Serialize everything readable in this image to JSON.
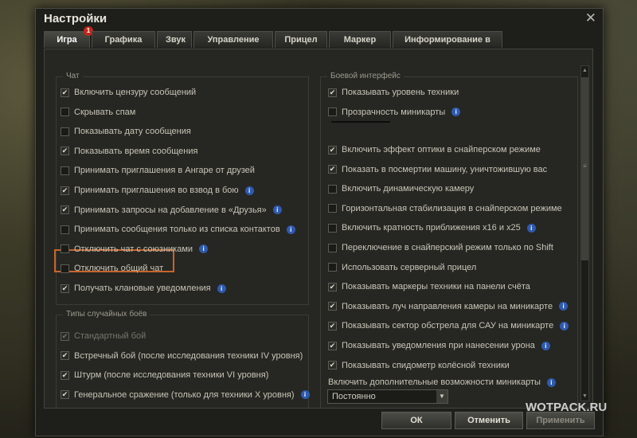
{
  "window": {
    "title": "Настройки",
    "close_glyph": "✕"
  },
  "tabs": [
    {
      "label": "Игра",
      "badge": "1"
    },
    {
      "label": "Графика"
    },
    {
      "label": "Звук"
    },
    {
      "label": "Управление"
    },
    {
      "label": "Прицел"
    },
    {
      "label": "Маркер"
    },
    {
      "label": "Информирование в бою"
    }
  ],
  "chat": {
    "title": "Чат",
    "items": [
      {
        "label": "Включить цензуру сообщений",
        "checked": true
      },
      {
        "label": "Скрывать спам",
        "checked": false
      },
      {
        "label": "Показывать дату сообщения",
        "checked": false
      },
      {
        "label": "Показывать время сообщения",
        "checked": true
      },
      {
        "label": "Принимать приглашения в Ангаре от друзей",
        "checked": false
      },
      {
        "label": "Принимать приглашения во взвод в бою",
        "checked": true,
        "info": true
      },
      {
        "label": "Принимать запросы на добавление в «Друзья»",
        "checked": true,
        "info": true
      },
      {
        "label": "Принимать сообщения только из списка контактов",
        "checked": false,
        "info": true
      },
      {
        "label": "Отключить чат с союзниками",
        "checked": false,
        "info": true
      },
      {
        "label": "Отключить общий чат",
        "checked": false
      },
      {
        "label": "Получать клановые уведомления",
        "checked": true,
        "info": true
      }
    ]
  },
  "battle_types": {
    "title": "Типы случайных боёв",
    "items": [
      {
        "label": "Стандартный бой",
        "checked": true,
        "disabled": true
      },
      {
        "label": "Встречный бой (после исследования техники IV уровня)",
        "checked": true
      },
      {
        "label": "Штурм (после исследования техники VI уровня)",
        "checked": true
      },
      {
        "label": "Генеральное сражение (только для техники X уровня)",
        "checked": true,
        "info": true
      }
    ]
  },
  "interface": {
    "title": "Боевой интерфейс",
    "items_top": [
      {
        "label": "Показывать уровень техники",
        "checked": true
      },
      {
        "label": "Прозрачность миникарты",
        "checked": false,
        "info": true
      }
    ],
    "items": [
      {
        "label": "Включить эффект оптики в снайперском режиме",
        "checked": true
      },
      {
        "label": "Показать в посмертии машину, уничтожившую вас",
        "checked": true
      },
      {
        "label": "Включить динамическую камеру",
        "checked": false
      },
      {
        "label": "Горизонтальная стабилизация в снайперском режиме",
        "checked": false
      },
      {
        "label": "Включить кратность приближения x16 и x25",
        "checked": false,
        "info": true
      },
      {
        "label": "Переключение в снайперский режим только по Shift",
        "checked": false
      },
      {
        "label": "Использовать серверный прицел",
        "checked": false
      },
      {
        "label": "Показывать маркеры техники на панели счёта",
        "checked": true
      },
      {
        "label": "Показывать луч направления камеры на миникарте",
        "checked": true,
        "info": true
      },
      {
        "label": "Показывать сектор обстрела для САУ на миникарте",
        "checked": true,
        "info": true
      },
      {
        "label": "Показывать уведомления при нанесении урона",
        "checked": true,
        "info": true
      },
      {
        "label": "Показывать спидометр колёсной техники",
        "checked": true
      }
    ],
    "minimap_extra_label": "Включить дополнительные возможности миникарты",
    "minimap_extra_value": "Постоянно"
  },
  "footer": {
    "ok_label": "ОК",
    "cancel_label": "Отменить",
    "apply_label": "Применить"
  },
  "watermark": "WOTPACK.RU",
  "icons": {
    "check": "✔",
    "info": "i",
    "dropdown": "▼",
    "scroll_up": "▲",
    "scroll_down": "▼",
    "grip": "≡"
  },
  "colors": {
    "highlight": "#c8642c",
    "info": "#2e5bb0",
    "badge": "#c0281b"
  }
}
